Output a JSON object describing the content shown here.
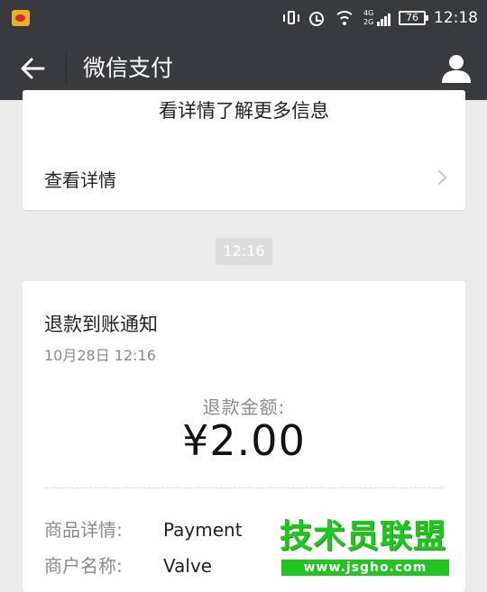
{
  "status_bar": {
    "icons": [
      "weibo-icon",
      "vibrate-icon",
      "alarm-icon",
      "wifi-icon",
      "signal-icon",
      "battery-icon"
    ],
    "net_top": "4G",
    "net_bottom": "2G",
    "battery": "76",
    "time": "12:18"
  },
  "nav": {
    "title": "微信支付"
  },
  "prev_card": {
    "tail_text": "看详情了解更多信息",
    "details_label": "查看详情"
  },
  "time_divider": "12:16",
  "notice": {
    "title": "退款到账通知",
    "date": "10月28日  12:16",
    "amount_label": "退款金额:",
    "amount_value": "¥2.00",
    "rows": [
      {
        "label": "商品详情:",
        "value": "Payment"
      },
      {
        "label": "商户名称:",
        "value": "Valve"
      }
    ]
  },
  "watermark": {
    "logo_text": "技术员联盟",
    "url": "www.jsgho.com"
  },
  "colors": {
    "header_bg": "#393a3f",
    "page_bg": "#ebebeb",
    "watermark_green": "#22c41f"
  }
}
